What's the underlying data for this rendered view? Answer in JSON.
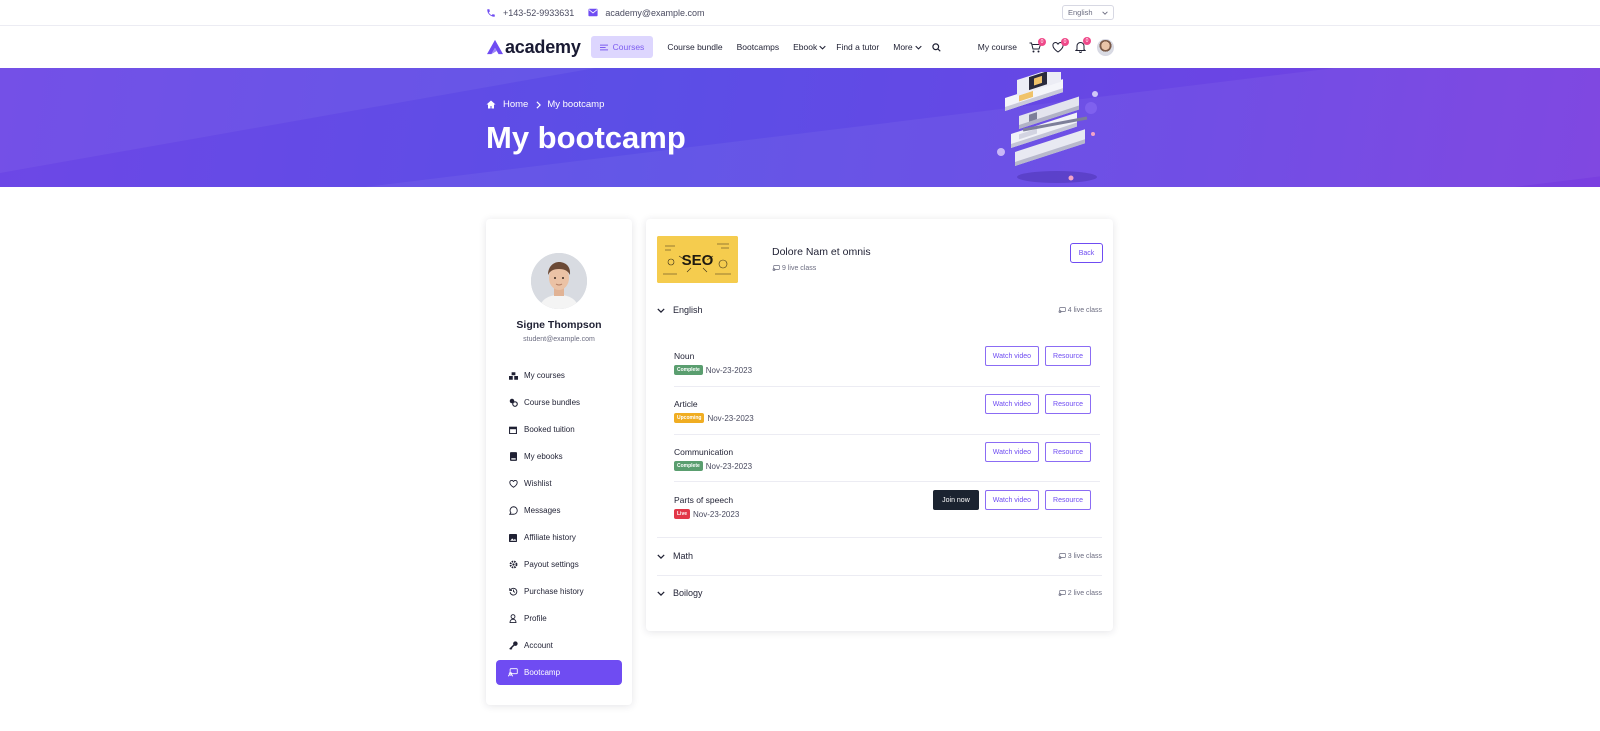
{
  "topbar": {
    "phone": "+143-52-9933631",
    "email": "academy@example.com",
    "language": "English"
  },
  "nav": {
    "logo": "academy",
    "items": [
      {
        "label": "Courses",
        "active": true
      },
      {
        "label": "Course bundle"
      },
      {
        "label": "Bootcamps"
      },
      {
        "label": "Ebook",
        "dropdown": true
      },
      {
        "label": "Find a tutor"
      },
      {
        "label": "More",
        "dropdown": true
      }
    ],
    "my_course": "My course",
    "cart_count": "0",
    "wishlist_count": "0",
    "notification_count": "0"
  },
  "hero": {
    "breadcrumb_home": "Home",
    "breadcrumb_current": "My bootcamp",
    "title": "My bootcamp"
  },
  "sidebar": {
    "name": "Signe Thompson",
    "email": "student@example.com",
    "items": [
      {
        "label": "My courses",
        "icon": "courses-icon"
      },
      {
        "label": "Course bundles",
        "icon": "bundles-icon"
      },
      {
        "label": "Booked tuition",
        "icon": "calendar-icon"
      },
      {
        "label": "My ebooks",
        "icon": "book-icon"
      },
      {
        "label": "Wishlist",
        "icon": "heart-icon"
      },
      {
        "label": "Messages",
        "icon": "chat-icon"
      },
      {
        "label": "Affiliate history",
        "icon": "image-icon"
      },
      {
        "label": "Payout settings",
        "icon": "gear-icon"
      },
      {
        "label": "Purchase history",
        "icon": "history-icon"
      },
      {
        "label": "Profile",
        "icon": "user-icon"
      },
      {
        "label": "Account",
        "icon": "key-icon"
      },
      {
        "label": "Bootcamp",
        "icon": "bootcamp-icon",
        "active": true
      }
    ]
  },
  "course": {
    "thumb_text": "SEO",
    "title": "Dolore Nam et omnis",
    "live_count": "9 live class",
    "back_label": "Back"
  },
  "sections": [
    {
      "name": "English",
      "count": "4 live class",
      "expanded": true
    },
    {
      "name": "Math",
      "count": "3 live class"
    },
    {
      "name": "Boilogy",
      "count": "2 live class"
    }
  ],
  "lessons": [
    {
      "name": "Noun",
      "status": "Complete",
      "date": "Nov-23-2023"
    },
    {
      "name": "Article",
      "status": "Upcoming",
      "date": "Nov-23-2023"
    },
    {
      "name": "Communication",
      "status": "Complete",
      "date": "Nov-23-2023"
    },
    {
      "name": "Parts of speech",
      "status": "Live",
      "date": "Nov-23-2023",
      "join": "Join now"
    }
  ],
  "buttons": {
    "watch": "Watch video",
    "resource": "Resource"
  },
  "colors": {
    "primary": "#6f4cf2",
    "complete": "#5a9e6f",
    "upcoming": "#f0ad22",
    "live": "#e23748"
  }
}
